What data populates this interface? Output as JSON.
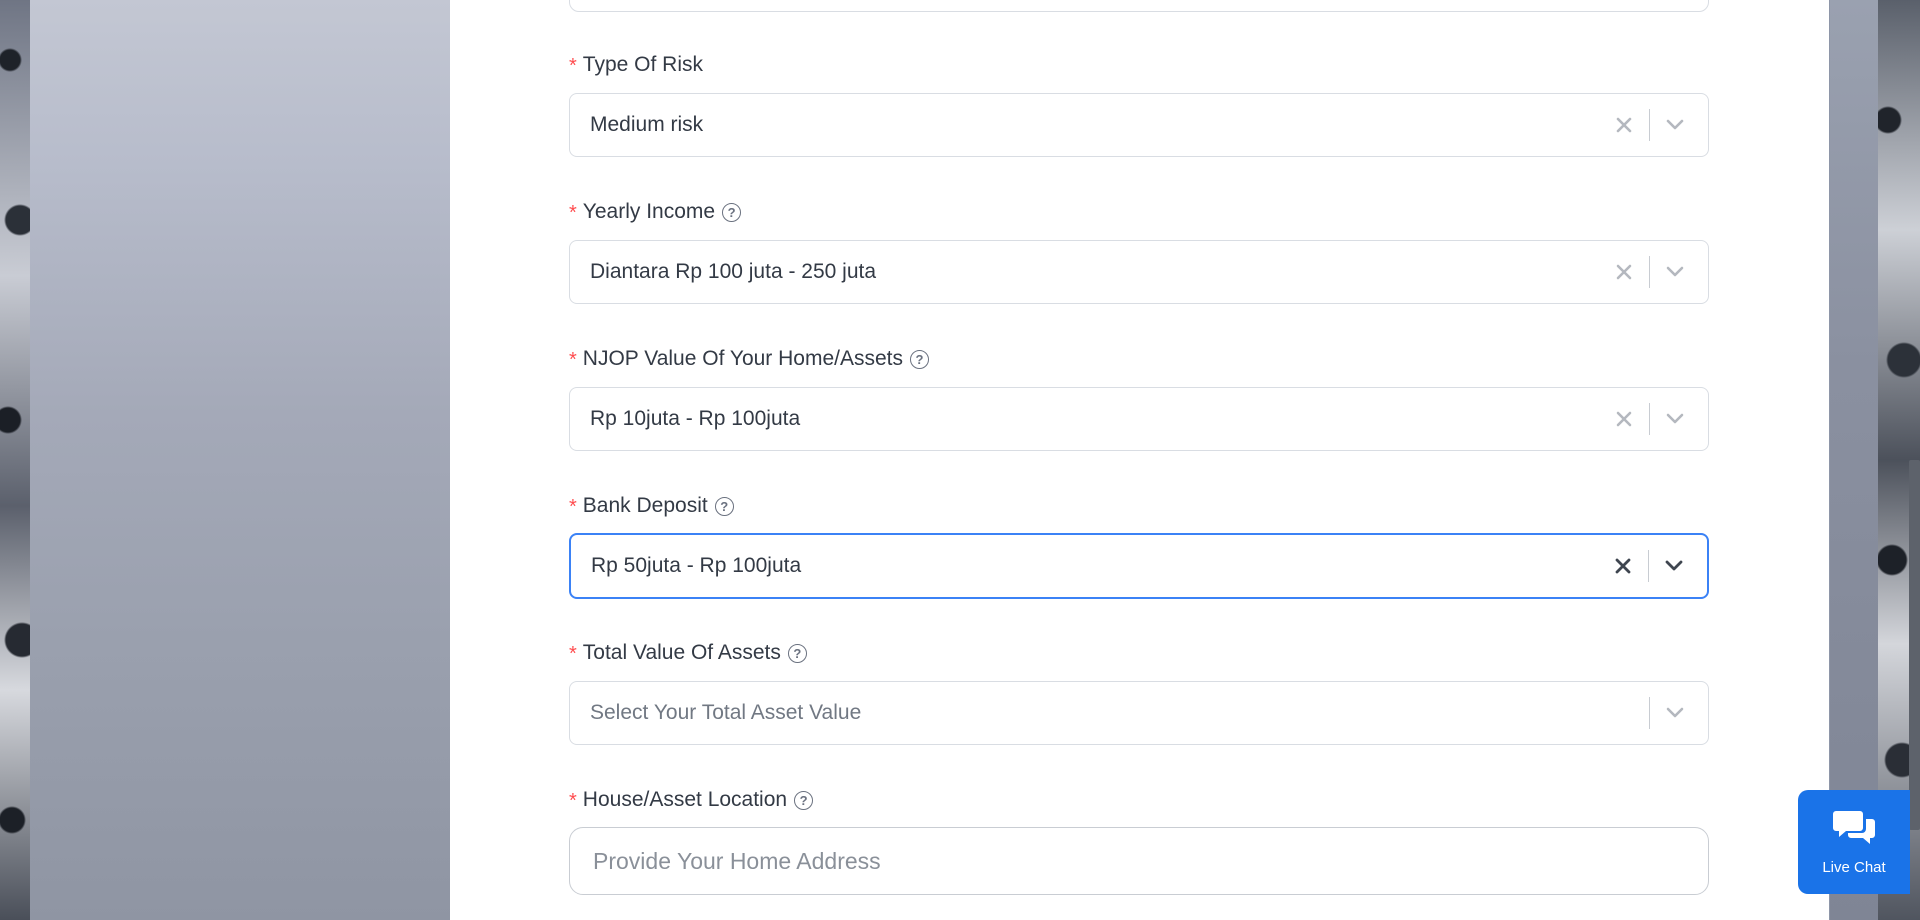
{
  "form": {
    "fields": [
      {
        "label": "Type Of Risk",
        "required": true,
        "has_help": false,
        "value": "Medium risk",
        "placeholder": "",
        "focused": false,
        "clearable": true
      },
      {
        "label": "Yearly Income",
        "required": true,
        "has_help": true,
        "value": "Diantara Rp 100 juta - 250 juta",
        "placeholder": "",
        "focused": false,
        "clearable": true
      },
      {
        "label": "NJOP Value Of Your Home/Assets",
        "required": true,
        "has_help": true,
        "value": "Rp 10juta - Rp 100juta",
        "placeholder": "",
        "focused": false,
        "clearable": true
      },
      {
        "label": "Bank Deposit",
        "required": true,
        "has_help": true,
        "value": "Rp 50juta - Rp 100juta",
        "placeholder": "",
        "focused": true,
        "clearable": true
      },
      {
        "label": "Total Value Of Assets",
        "required": true,
        "has_help": true,
        "value": "",
        "placeholder": "Select Your Total Asset Value",
        "focused": false,
        "clearable": false
      }
    ],
    "location": {
      "label": "House/Asset Location",
      "required": true,
      "has_help": true,
      "value": "",
      "placeholder": "Provide Your Home Address"
    },
    "required_mark": "*",
    "help_glyph": "?"
  },
  "live_chat": {
    "label": "Live Chat",
    "icon": "chat-bubbles-icon"
  },
  "colors": {
    "accent": "#3b82f6",
    "required": "#ff4d4f",
    "live_chat_bg": "#1a73e8"
  }
}
